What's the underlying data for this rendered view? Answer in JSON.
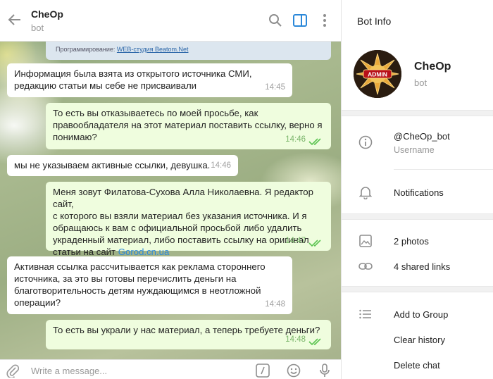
{
  "header": {
    "title": "CheOp",
    "subtitle": "bot",
    "icons": [
      "back-arrow-icon",
      "search-icon",
      "sidebar-toggle-icon",
      "more-vertical-icon"
    ]
  },
  "preview": {
    "label": "Программирование:",
    "link": "WEB-студия Beatom.Net"
  },
  "messages": [
    {
      "dir": "in",
      "lines": [
        "Информация была взята из открытого источника СМИ,",
        "редакцию статьи мы себе не присваивали"
      ],
      "time": "14:45"
    },
    {
      "dir": "out",
      "lines": [
        "То есть вы отказываетесь по моей просьбе, как",
        "правообладателя на этот материал поставить ссылку, верно я",
        "понимаю?"
      ],
      "time": "14:46"
    },
    {
      "dir": "in",
      "lines": [
        "мы не указываем активные ссылки, девушка."
      ],
      "time": "14:46"
    },
    {
      "dir": "out",
      "lines": [
        "Меня зовут Филатова-Сухова Алла Николаевна. Я редактор сайт,",
        "с которого вы взяли материал без указания источника. И я",
        "обращаюсь к вам с официальной просьбой либо удалить",
        "украденный материал, либо поставить ссылку на оригинал",
        "статьи на сайт "
      ],
      "link": "Gorod.cn.ua",
      "time": "14:47"
    },
    {
      "dir": "in",
      "lines": [
        "Активная ссылка рассчитывается как реклама стороннего",
        "источника, за это вы готовы перечислить деньги на",
        "благотворительность детям нуждающимся в неотложной",
        "операции?"
      ],
      "time": "14:48"
    },
    {
      "dir": "out",
      "lines": [
        "То есть вы украли у нас материал, а теперь требуете деньги?"
      ],
      "time": "14:48"
    }
  ],
  "composer": {
    "placeholder": "Write a message...",
    "icons": [
      "attach-icon",
      "bot-command-icon",
      "emoji-icon",
      "microphone-icon"
    ]
  },
  "info_panel": {
    "title": "Bot Info",
    "name": "CheOp",
    "subtitle": "bot",
    "avatar_text": "ADMIN",
    "username": "@CheOp_bot",
    "username_label": "Username",
    "notifications": "Notifications",
    "photos": "2 photos",
    "links": "4 shared links",
    "add_to_group": "Add to Group",
    "clear_history": "Clear history",
    "delete_chat": "Delete chat"
  },
  "colors": {
    "accent": "#2b88d9",
    "outgoing_bubble": "#effdde",
    "incoming_bubble": "#ffffff",
    "check_green": "#5dc452"
  }
}
